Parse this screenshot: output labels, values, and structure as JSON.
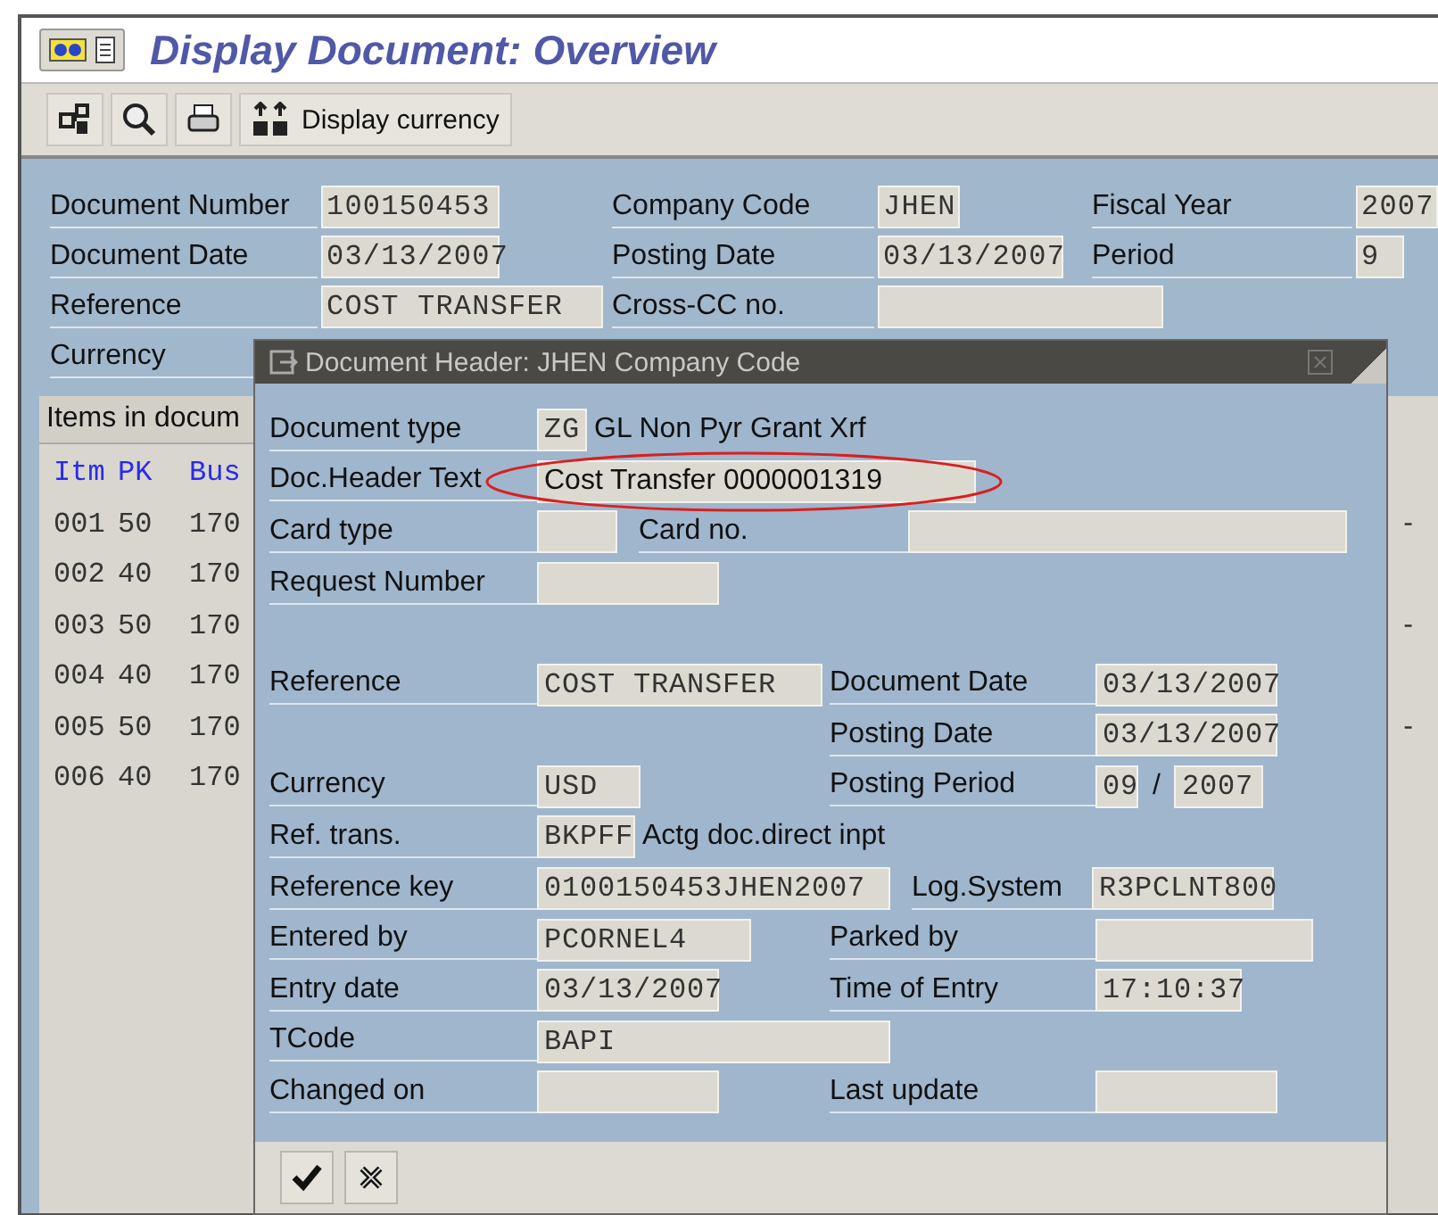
{
  "window": {
    "title": "Display Document: Overview"
  },
  "toolbar": {
    "buttons": [
      {
        "kind": "icon"
      },
      {
        "kind": "icon"
      },
      {
        "kind": "icon"
      },
      {
        "kind": "labeled",
        "label": "Display currency"
      }
    ]
  },
  "header_fields": [
    {
      "cells": [
        {
          "kind": "label",
          "text": "Document Number"
        },
        {
          "kind": "field",
          "value": "100150453"
        },
        {
          "kind": "label",
          "text": "Company Code"
        },
        {
          "kind": "field",
          "value": "JHEN"
        },
        {
          "kind": "label",
          "text": "Fiscal Year"
        },
        {
          "kind": "field",
          "value": "2007"
        }
      ]
    },
    {
      "cells": [
        {
          "kind": "label",
          "text": "Document Date"
        },
        {
          "kind": "field",
          "value": "03/13/2007"
        },
        {
          "kind": "label",
          "text": "Posting Date"
        },
        {
          "kind": "field",
          "value": "03/13/2007"
        },
        {
          "kind": "label",
          "text": "Period"
        },
        {
          "kind": "field",
          "value": "9"
        }
      ]
    },
    {
      "cells": [
        {
          "kind": "label",
          "text": "Reference"
        },
        {
          "kind": "field",
          "value": "COST TRANSFER"
        },
        {
          "kind": "label",
          "text": "Cross-CC no."
        },
        {
          "kind": "field"
        }
      ]
    },
    {
      "cells": [
        {
          "kind": "label",
          "text": "Currency"
        }
      ]
    }
  ],
  "items_panel": {
    "title": "Items in docum",
    "columns": [
      "Itm",
      "PK",
      "Bus"
    ],
    "rows": [
      {
        "item": "001",
        "pk": "50",
        "bus": "170",
        "sign": "-"
      },
      {
        "item": "002",
        "pk": "40",
        "bus": "170"
      },
      {
        "item": "003",
        "pk": "50",
        "bus": "170",
        "sign": "-"
      },
      {
        "item": "004",
        "pk": "40",
        "bus": "170"
      },
      {
        "item": "005",
        "pk": "50",
        "bus": "170",
        "sign": "-"
      },
      {
        "item": "006",
        "pk": "40",
        "bus": "170"
      }
    ]
  },
  "dialog": {
    "title": "Document Header: JHEN Company Code",
    "rows": [
      {
        "cells": [
          {
            "kind": "label",
            "text": "Document type"
          },
          {
            "kind": "field",
            "value": "ZG"
          },
          {
            "kind": "text",
            "text": "GL Non Pyr Grant Xrf"
          }
        ]
      },
      {
        "cells": [
          {
            "kind": "label",
            "text": "Doc.Header Text"
          },
          {
            "kind": "free-field",
            "value": "Cost Transfer 0000001319",
            "circled": true
          }
        ]
      },
      {
        "cells": [
          {
            "kind": "label",
            "text": "Card type"
          },
          {
            "kind": "field"
          },
          {
            "kind": "label",
            "text": "Card no."
          },
          {
            "kind": "field"
          }
        ]
      },
      {
        "cells": [
          {
            "kind": "label",
            "text": "Request Number"
          },
          {
            "kind": "field"
          }
        ]
      },
      {
        "cells": [
          {
            "kind": "label",
            "text": "Reference"
          },
          {
            "kind": "field",
            "value": "COST TRANSFER"
          },
          {
            "kind": "label",
            "text": "Document Date"
          },
          {
            "kind": "field",
            "value": "03/13/2007"
          }
        ]
      },
      {
        "cells": [
          {
            "kind": "empty"
          },
          {
            "kind": "empty"
          },
          {
            "kind": "label",
            "text": "Posting Date"
          },
          {
            "kind": "field",
            "value": "03/13/2007"
          }
        ]
      },
      {
        "cells": [
          {
            "kind": "label",
            "text": "Currency"
          },
          {
            "kind": "field",
            "value": "USD"
          },
          {
            "kind": "label",
            "text": "Posting Period"
          },
          {
            "kind": "field",
            "value": "09"
          },
          {
            "kind": "text",
            "text": "/"
          },
          {
            "kind": "field",
            "value": "2007"
          }
        ]
      },
      {
        "cells": [
          {
            "kind": "label",
            "text": "Ref. trans."
          },
          {
            "kind": "field",
            "value": "BKPFF"
          },
          {
            "kind": "text",
            "text": "Actg doc.direct inpt"
          }
        ]
      },
      {
        "cells": [
          {
            "kind": "label",
            "text": "Reference key"
          },
          {
            "kind": "field",
            "value": "0100150453JHEN2007"
          },
          {
            "kind": "label",
            "text": "Log.System"
          },
          {
            "kind": "field",
            "value": "R3PCLNT800"
          }
        ]
      },
      {
        "cells": [
          {
            "kind": "label",
            "text": "Entered by"
          },
          {
            "kind": "field",
            "value": "PCORNEL4"
          },
          {
            "kind": "label",
            "text": "Parked by"
          },
          {
            "kind": "field"
          }
        ]
      },
      {
        "cells": [
          {
            "kind": "label",
            "text": "Entry date"
          },
          {
            "kind": "field",
            "value": "03/13/2007"
          },
          {
            "kind": "label",
            "text": "Time of Entry"
          },
          {
            "kind": "field",
            "value": "17:10:37"
          }
        ]
      },
      {
        "cells": [
          {
            "kind": "label",
            "text": "TCode"
          },
          {
            "kind": "field",
            "value": "BAPI"
          }
        ]
      },
      {
        "cells": [
          {
            "kind": "label",
            "text": "Changed on"
          },
          {
            "kind": "field"
          },
          {
            "kind": "label",
            "text": "Last update"
          },
          {
            "kind": "field"
          }
        ]
      }
    ],
    "buttons": [
      {
        "kind": "confirm"
      },
      {
        "kind": "cancel"
      }
    ]
  }
}
